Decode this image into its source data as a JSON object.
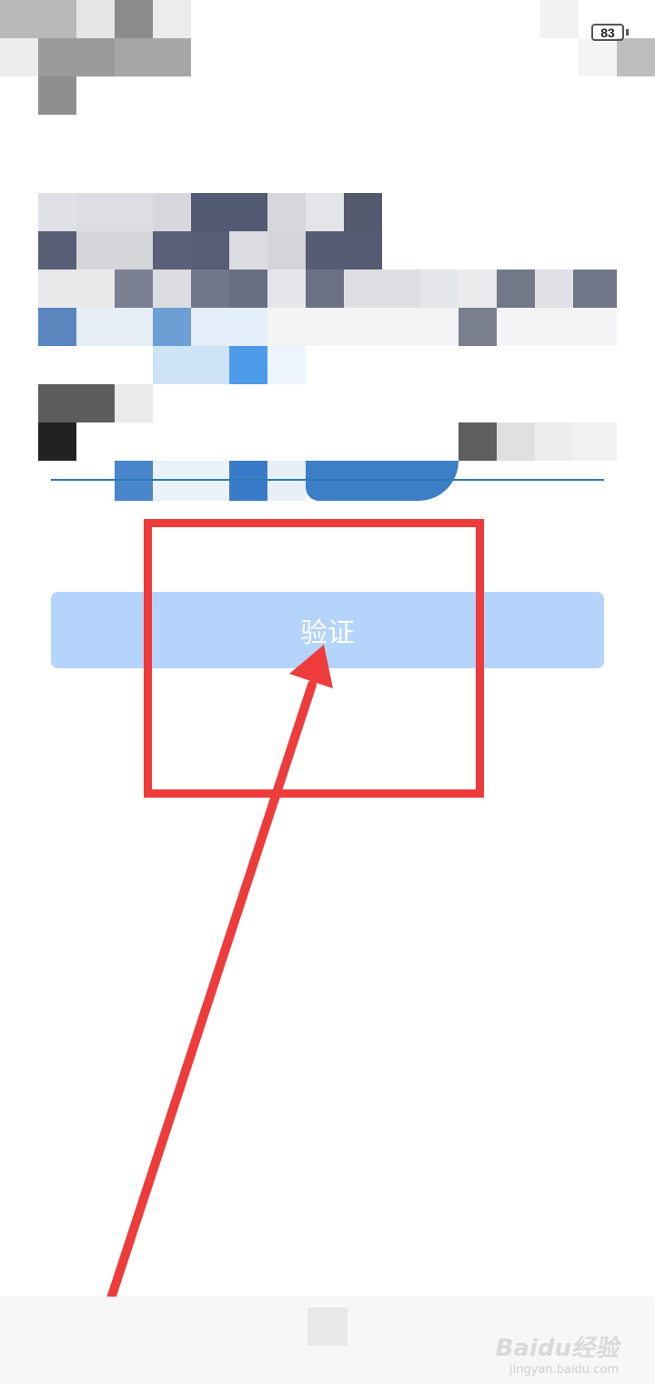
{
  "status_bar": {
    "battery_level": "83"
  },
  "form": {
    "verify_button_label": "验证"
  },
  "watermark": {
    "brand": "Baidu经验",
    "url": "jingyan.baidu.com"
  },
  "annotation": {
    "color": "#ee3b3b"
  },
  "colors": {
    "button_bg": "#b4d4fb",
    "underline": "#2b7bb4"
  }
}
